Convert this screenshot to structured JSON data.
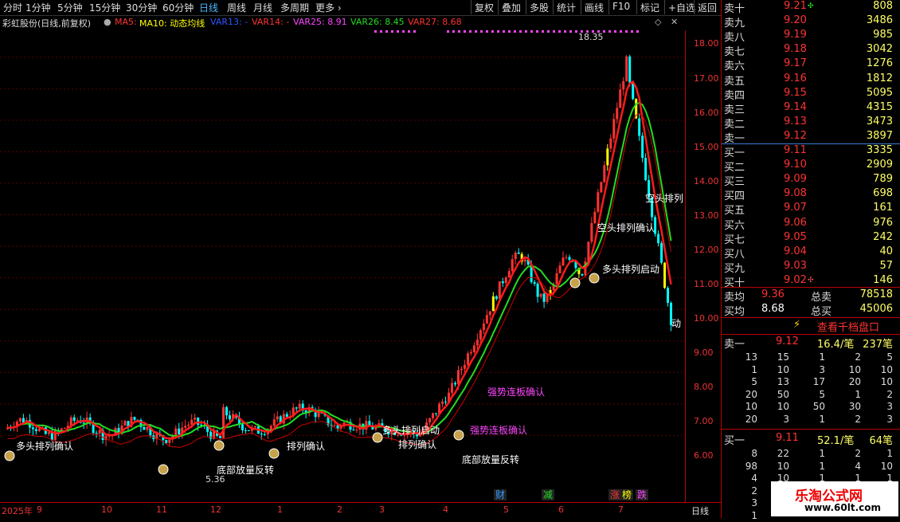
{
  "periods": [
    "分时",
    "1分钟",
    "5分钟",
    "15分钟",
    "30分钟",
    "60分钟",
    "日线",
    "周线",
    "月线",
    "多周期",
    "更多"
  ],
  "active_period": "日线",
  "toolbar": [
    "复权",
    "叠加",
    "多股",
    "统计",
    "画线",
    "F10",
    "标记",
    "+自选",
    "返回"
  ],
  "info": {
    "stock": "彩虹股份(日线,前复权)",
    "ma5": "MA5:",
    "ma10": "MA10: 动态均线",
    "var13": "VAR13: -",
    "var14": "VAR14: -",
    "var25": "VAR25: 8.91",
    "var26": "VAR26: 8.45",
    "var27": "VAR27: 8.68"
  },
  "y_ticks": [
    "18.00",
    "17.00",
    "16.00",
    "15.00",
    "14.00",
    "13.00",
    "12.00",
    "11.00",
    "10.00",
    "9.00",
    "8.00",
    "7.00",
    "6.00"
  ],
  "x_ticks": [
    "2025年",
    "9",
    "10",
    "11",
    "12",
    "1",
    "2",
    "3",
    "4",
    "5",
    "6",
    "7"
  ],
  "x_right_label": "日线",
  "peak_label": "18.35",
  "low_label": "5.36",
  "annotations": [
    "多头排列确认",
    "多头排列启动",
    "底部放量反转",
    "强势连板确认",
    "空头排列",
    "空头排列确认",
    "排列确认",
    "动"
  ],
  "bottom_marks": [
    "财",
    "减",
    "涨",
    "榜",
    "跌"
  ],
  "colors": {
    "up": "#ff3333",
    "down": "#00ffff",
    "ma_red": "#ff1a1a",
    "ma_green": "#22dd22",
    "yellow": "#ffff00",
    "magenta": "#ff44ff"
  },
  "orderbook": {
    "sells": [
      {
        "label": "卖十",
        "price": "9.21",
        "vol": "808"
      },
      {
        "label": "卖九",
        "price": "9.20",
        "vol": "3486"
      },
      {
        "label": "卖八",
        "price": "9.19",
        "vol": "985"
      },
      {
        "label": "卖七",
        "price": "9.18",
        "vol": "3042"
      },
      {
        "label": "卖六",
        "price": "9.17",
        "vol": "1276"
      },
      {
        "label": "卖五",
        "price": "9.16",
        "vol": "1812"
      },
      {
        "label": "卖四",
        "price": "9.15",
        "vol": "5095"
      },
      {
        "label": "卖三",
        "price": "9.14",
        "vol": "4315"
      },
      {
        "label": "卖二",
        "price": "9.13",
        "vol": "3473"
      },
      {
        "label": "卖一",
        "price": "9.12",
        "vol": "3897"
      }
    ],
    "buys": [
      {
        "label": "买一",
        "price": "9.11",
        "vol": "3335"
      },
      {
        "label": "买二",
        "price": "9.10",
        "vol": "2909"
      },
      {
        "label": "买三",
        "price": "9.09",
        "vol": "789"
      },
      {
        "label": "买四",
        "price": "9.08",
        "vol": "698"
      },
      {
        "label": "买五",
        "price": "9.07",
        "vol": "161"
      },
      {
        "label": "买六",
        "price": "9.06",
        "vol": "976"
      },
      {
        "label": "买七",
        "price": "9.05",
        "vol": "242"
      },
      {
        "label": "买八",
        "price": "9.04",
        "vol": "40"
      },
      {
        "label": "买九",
        "price": "9.03",
        "vol": "57"
      },
      {
        "label": "买十",
        "price": "9.02",
        "vol": "146"
      }
    ],
    "avg_sell": {
      "label": "卖均",
      "price": "9.36",
      "total_label": "总卖",
      "total": "78518"
    },
    "avg_buy": {
      "label": "买均",
      "price": "8.68",
      "total_label": "总买",
      "total": "45006"
    },
    "view_button": "查看千档盘口",
    "sell1_row": {
      "label": "卖一",
      "price": "9.12",
      "per": "16.4/笔",
      "count": "237笔"
    },
    "sell1_grid": [
      [
        "13",
        "15",
        "1",
        "2",
        "5"
      ],
      [
        "1",
        "10",
        "3",
        "10",
        "10"
      ],
      [
        "5",
        "13",
        "17",
        "20",
        "10"
      ],
      [
        "20",
        "50",
        "5",
        "1",
        "2"
      ],
      [
        "10",
        "10",
        "50",
        "30",
        "3"
      ],
      [
        "20",
        "3",
        "1",
        "2",
        "3"
      ]
    ],
    "buy1_row": {
      "label": "买一",
      "price": "9.11",
      "per": "52.1/笔",
      "count": "64笔"
    },
    "buy1_grid": [
      [
        "8",
        "22",
        "1",
        "2",
        "1"
      ],
      [
        "98",
        "10",
        "1",
        "4",
        "10"
      ],
      [
        "4",
        "10",
        "1",
        "1",
        "1"
      ],
      [
        "2",
        "",
        "",
        "",
        ""
      ],
      [
        "3",
        "",
        "",
        "",
        ""
      ],
      [
        "1",
        "",
        "",
        "",
        ""
      ]
    ]
  },
  "watermark": {
    "title": "乐淘公式网",
    "url": "www.60lt.com"
  }
}
